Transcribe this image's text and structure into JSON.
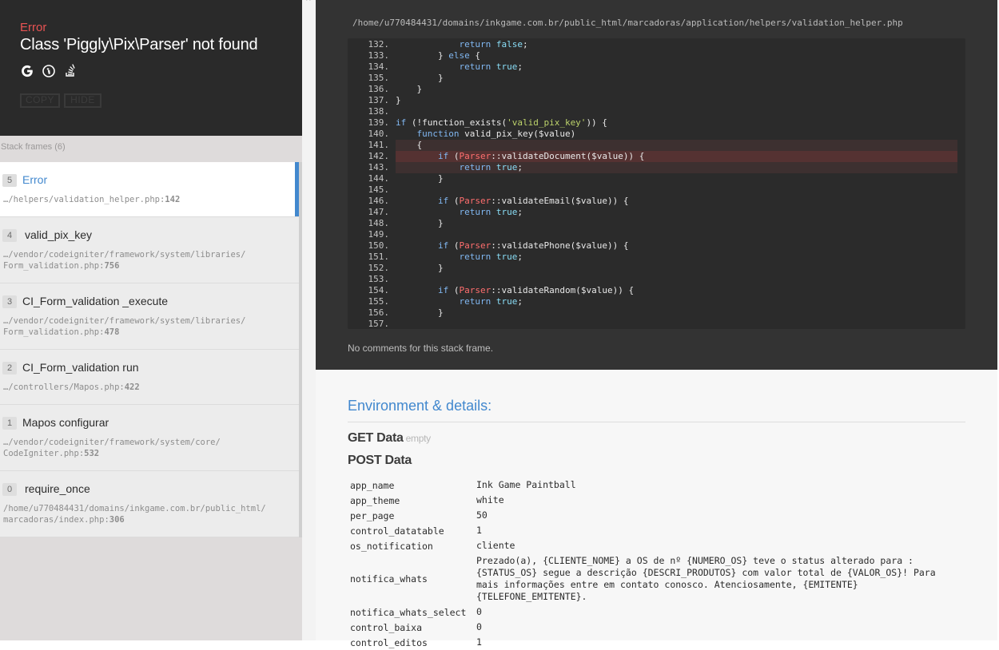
{
  "header": {
    "exception_type": "Error",
    "exception_message": "Class 'Piggly\\Pix\\Parser' not found",
    "search_icons": [
      "google-icon",
      "duckduckgo-icon",
      "stackoverflow-icon"
    ],
    "copy_label": "COPY",
    "hide_label": "HIDE"
  },
  "frames_panel": {
    "label": "Stack frames",
    "count": "(6)"
  },
  "frames": [
    {
      "index": "5",
      "title": "Error",
      "file": "…/helpers/validation_helper.php",
      "line": "142",
      "active": true
    },
    {
      "index": "4",
      "title": "valid_pix_key",
      "file": "…/vendor/codeigniter/framework/system/libraries/",
      "file2": "Form_validation.php",
      "line": "756"
    },
    {
      "index": "3",
      "title": "CI_Form_validation _execute",
      "file": "…/vendor/codeigniter/framework/system/libraries/",
      "file2": "Form_validation.php",
      "line": "478"
    },
    {
      "index": "2",
      "title": "CI_Form_validation run",
      "file": "…/controllers/Mapos.php",
      "line": "422"
    },
    {
      "index": "1",
      "title": "Mapos configurar",
      "file": "…/vendor/codeigniter/framework/system/core/",
      "file2": "CodeIgniter.php",
      "line": "532"
    },
    {
      "index": "0",
      "title": "require_once",
      "file": "/home/u770484431/domains/inkgame.com.br/public_html/",
      "file2": "marcadoras/index.php",
      "line": "306"
    }
  ],
  "code": {
    "file_path": "/home/u770484431/domains/inkgame.com.br/public_html/marcadoras/application/helpers/validation_helper.php",
    "highlighted_line": "142",
    "lines": [
      {
        "n": "132.",
        "text": "            return false;"
      },
      {
        "n": "133.",
        "text": "        } else {"
      },
      {
        "n": "134.",
        "text": "            return true;"
      },
      {
        "n": "135.",
        "text": "        }"
      },
      {
        "n": "136.",
        "text": "    }"
      },
      {
        "n": "137.",
        "text": "}"
      },
      {
        "n": "138.",
        "text": ""
      },
      {
        "n": "139.",
        "text": "if (!function_exists('valid_pix_key')) {"
      },
      {
        "n": "140.",
        "text": "    function valid_pix_key($value)"
      },
      {
        "n": "141.",
        "text": "    {"
      },
      {
        "n": "142.",
        "text": "        if (Parser::validateDocument($value)) {"
      },
      {
        "n": "143.",
        "text": "            return true;"
      },
      {
        "n": "144.",
        "text": "        }"
      },
      {
        "n": "145.",
        "text": ""
      },
      {
        "n": "146.",
        "text": "        if (Parser::validateEmail($value)) {"
      },
      {
        "n": "147.",
        "text": "            return true;"
      },
      {
        "n": "148.",
        "text": "        }"
      },
      {
        "n": "149.",
        "text": ""
      },
      {
        "n": "150.",
        "text": "        if (Parser::validatePhone($value)) {"
      },
      {
        "n": "151.",
        "text": "            return true;"
      },
      {
        "n": "152.",
        "text": "        }"
      },
      {
        "n": "153.",
        "text": ""
      },
      {
        "n": "154.",
        "text": "        if (Parser::validateRandom($value)) {"
      },
      {
        "n": "155.",
        "text": "            return true;"
      },
      {
        "n": "156.",
        "text": "        }"
      },
      {
        "n": "157.",
        "text": ""
      }
    ],
    "comments": "No comments for this stack frame."
  },
  "details": {
    "title": "Environment & details:",
    "get_title": "GET Data",
    "get_empty": "empty",
    "post_title": "POST Data",
    "post_rows": [
      {
        "key": "app_name",
        "value": "Ink Game Paintball"
      },
      {
        "key": "app_theme",
        "value": "white"
      },
      {
        "key": "per_page",
        "value": "50"
      },
      {
        "key": "control_datatable",
        "value": "1"
      },
      {
        "key": "os_notification",
        "value": "cliente"
      },
      {
        "key": "notifica_whats",
        "value": "Prezado(a), {CLIENTE_NOME} a OS de nº {NUMERO_OS} teve o status alterado para :{STATUS_OS} segue a descrição {DESCRI_PRODUTOS} com valor total de {VALOR_OS}! Para mais informações entre em contato conosco. Atenciosamente, {EMITENTE} {TELEFONE_EMITENTE}."
      },
      {
        "key": "notifica_whats_select",
        "value": "0"
      },
      {
        "key": "control_baixa",
        "value": "0"
      },
      {
        "key": "control_editos",
        "value": "1"
      }
    ]
  },
  "colors": {
    "accent": "#4288ce",
    "error": "#e95353",
    "header_bg": "#2a2a2a",
    "code_bg": "#2b2b2b"
  }
}
